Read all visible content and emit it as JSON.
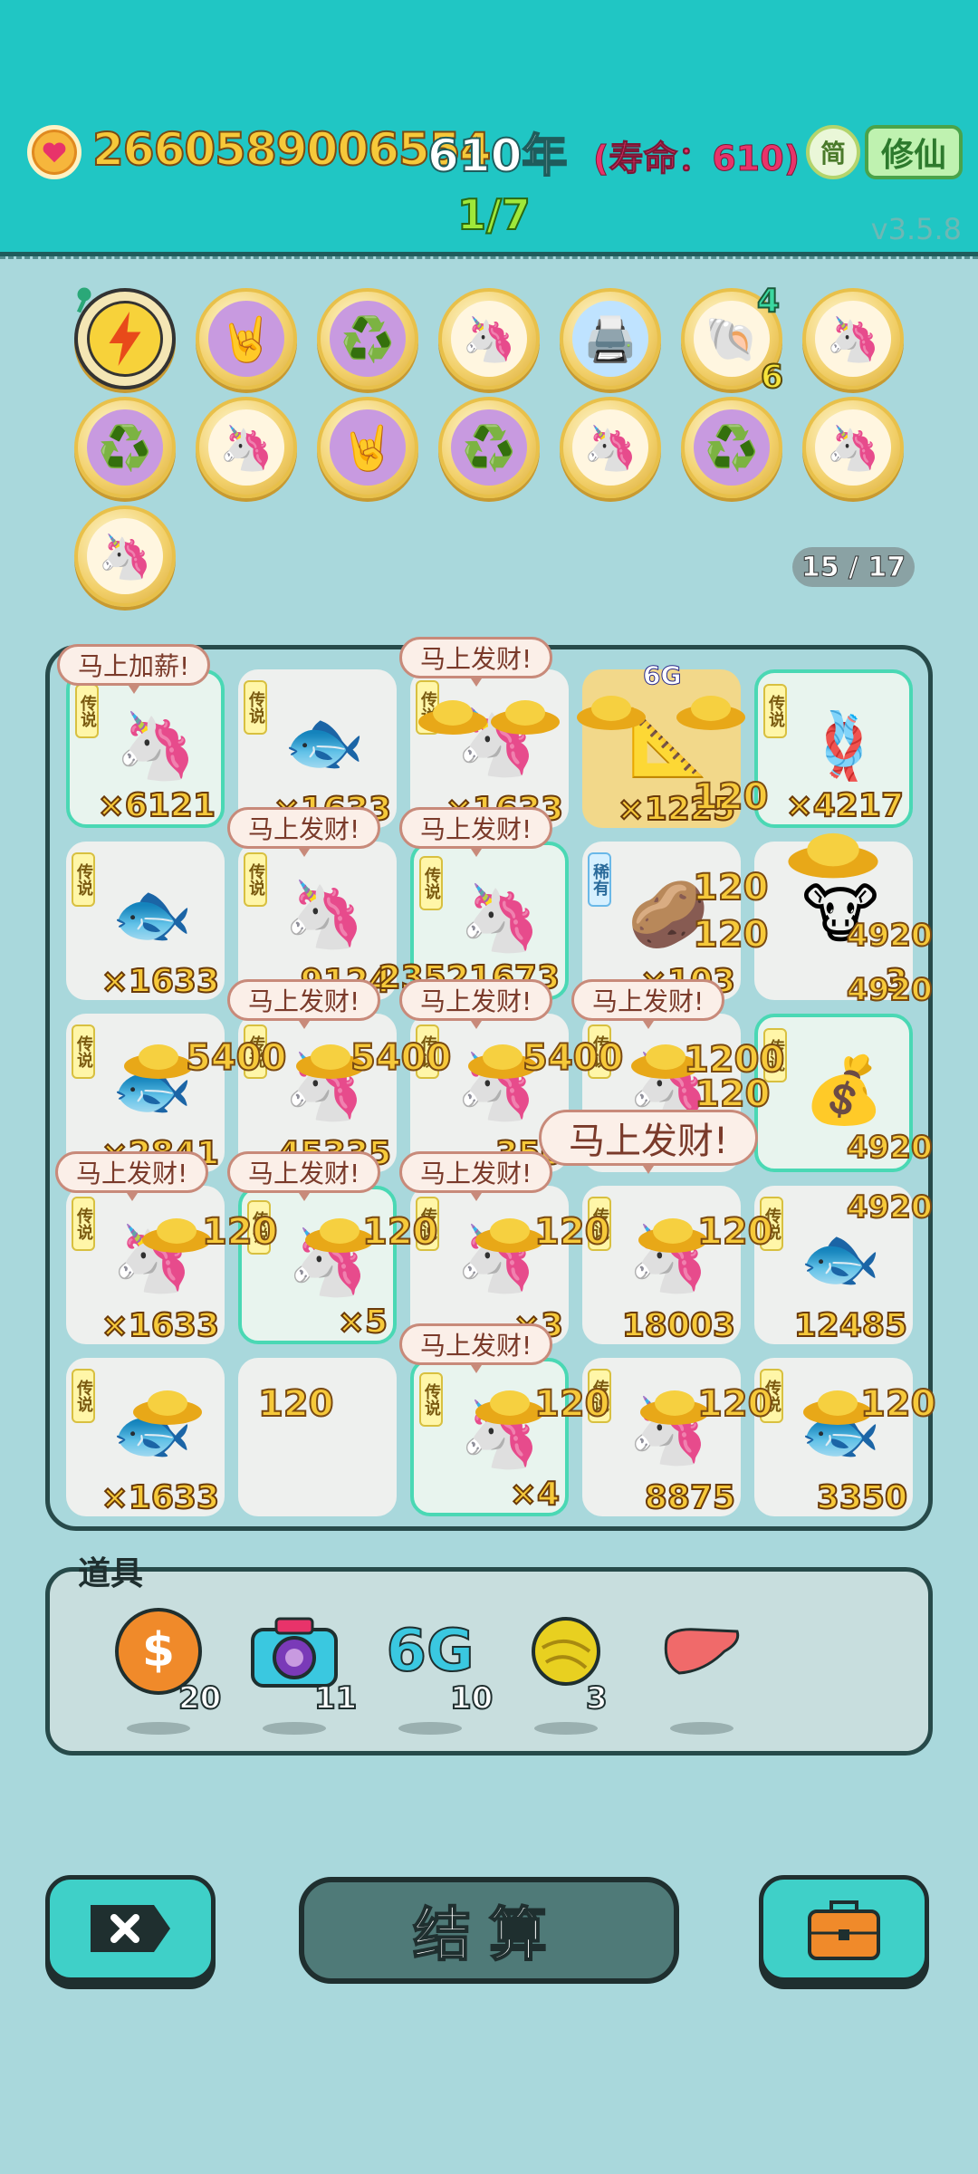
{
  "header": {
    "coins": "2660589006554",
    "years": "610年",
    "lifespan": "(寿命：610)",
    "simplified_label": "简",
    "cultivate_label": "修仙",
    "stage": "1/7",
    "version": "v3.5.8"
  },
  "relics": {
    "shell_top": "4",
    "shell_bottom": "6",
    "page": "15 / 17",
    "icons": [
      "lightning-icon",
      "rock-hand-icon",
      "recycle-icon",
      "unicorn-icon",
      "printer-icon",
      "shell-icon",
      "unicorn-icon",
      "recycle-icon",
      "unicorn-icon",
      "rock-hand-icon",
      "recycle-icon",
      "unicorn-icon",
      "recycle-icon",
      "unicorn-icon",
      "unicorn-icon"
    ]
  },
  "board": {
    "bubbles": {
      "raise": "马上加薪!",
      "rich": "马上发财!"
    },
    "cells": [
      {
        "tag": "传说",
        "count": "×6121"
      },
      {
        "tag": "传说",
        "count": "×1633"
      },
      {
        "tag": "传说",
        "count": "×1633"
      },
      {
        "tag": "",
        "count": "×1225"
      },
      {
        "tag": "传说",
        "count": "×4217"
      },
      {
        "tag": "传说",
        "count": "×1633"
      },
      {
        "tag": "传说",
        "count": "9124"
      },
      {
        "tag": "传说",
        "count": "23521673"
      },
      {
        "tag": "稀有",
        "count": "×103"
      },
      {
        "tag": "",
        "count": "3"
      },
      {
        "tag": "传说",
        "count": "×2841"
      },
      {
        "tag": "传说",
        "count": "45335"
      },
      {
        "tag": "传说",
        "count": "350"
      },
      {
        "tag": "传说",
        "count": ""
      },
      {
        "tag": "传说",
        "count": ""
      },
      {
        "tag": "传说",
        "count": "×1633"
      },
      {
        "tag": "传说",
        "count": "×5"
      },
      {
        "tag": "传说",
        "count": "×3"
      },
      {
        "tag": "传说",
        "count": "18003"
      },
      {
        "tag": "传说",
        "count": "12485"
      },
      {
        "tag": "传说",
        "count": "×1633"
      },
      {
        "tag": "",
        "count": ""
      },
      {
        "tag": "传说",
        "count": "×4"
      },
      {
        "tag": "传说",
        "count": "8875"
      },
      {
        "tag": "传说",
        "count": "3350"
      }
    ],
    "gains": {
      "g120": "120",
      "g5400": "5400",
      "g4920": "4920",
      "g1200": "1200",
      "g6g": "6G"
    }
  },
  "items": {
    "title": "道具",
    "list": [
      {
        "icon": "dollar-coin-icon",
        "count": "20"
      },
      {
        "icon": "camera-icon",
        "count": "11"
      },
      {
        "icon": "6g-icon",
        "label": "6G",
        "count": "10"
      },
      {
        "icon": "golden-orb-icon",
        "count": "3"
      },
      {
        "icon": "liver-icon",
        "count": ""
      }
    ]
  },
  "footer": {
    "settle_label": "结算"
  },
  "colors": {
    "header_bg": "#20c6c4",
    "page_bg": "#a9d8dc",
    "gold": "#f6c93a",
    "lifespan": "#e8336a"
  }
}
